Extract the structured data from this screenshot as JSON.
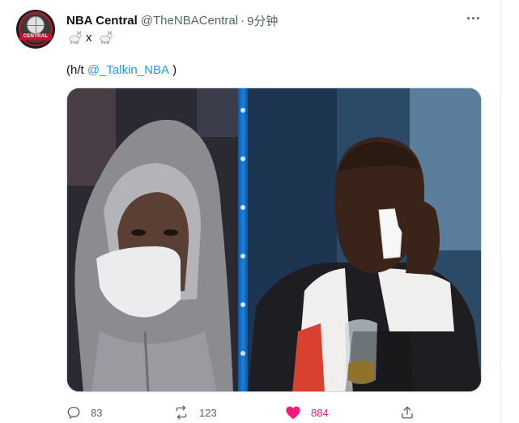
{
  "tweet": {
    "author_name": "NBA Central",
    "author_handle": "@TheNBACentral",
    "separator": "·",
    "timestamp": "9分钟",
    "avatar_text": "CENTRAL",
    "text_line1": {
      "emoji_left": "goat-emoji",
      "middle": "x",
      "emoji_right": "goat-emoji"
    },
    "text_line2": {
      "prefix": "(h/t ",
      "mention": "@_Talkin_NBA",
      "suffix": " )"
    }
  },
  "actions": {
    "reply_count": "83",
    "retweet_count": "123",
    "like_count": "884",
    "liked": true
  },
  "colors": {
    "mention": "#1d9bf0",
    "like_active": "#f91880",
    "muted": "#536471",
    "avatar_accent": "#c8102e"
  },
  "icons": [
    "more-icon",
    "reply-icon",
    "retweet-icon",
    "heart-icon",
    "share-icon"
  ]
}
